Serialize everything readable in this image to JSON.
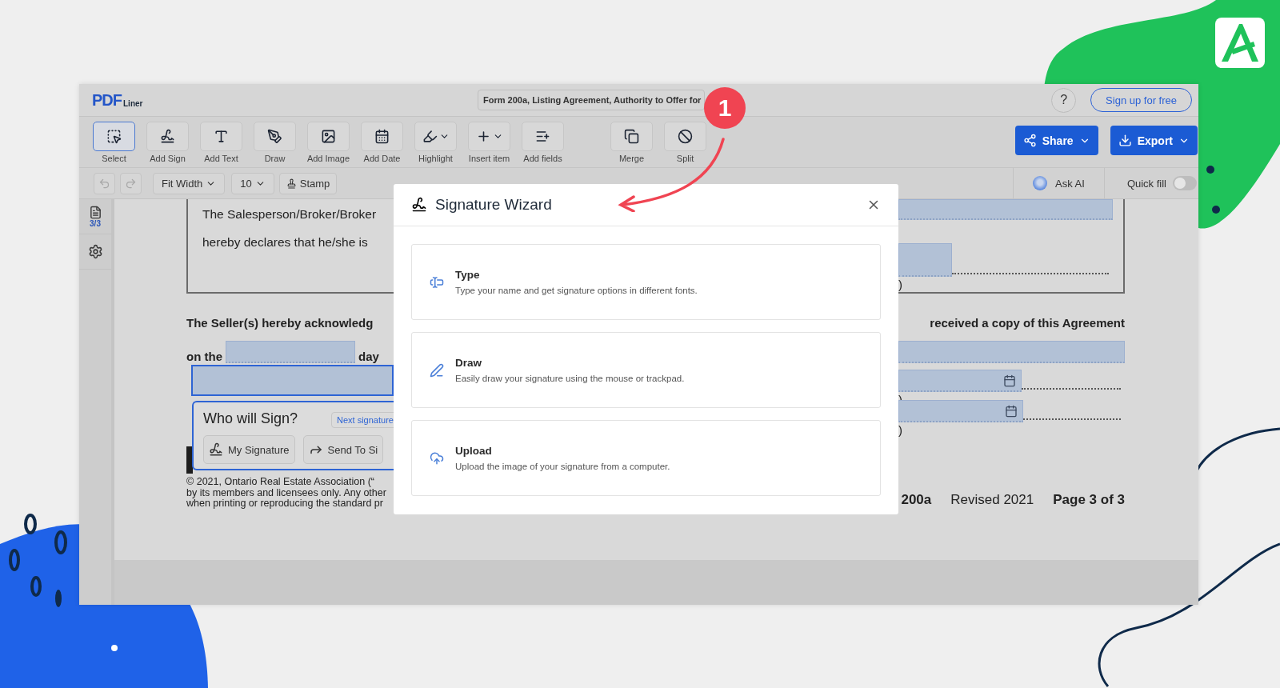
{
  "header": {
    "logo": {
      "mark": "PDF",
      "sub": "Liner"
    },
    "document_title": "Form 200a, Listing Agreement, Authority to Offer for",
    "help": "?",
    "signup": "Sign up for free"
  },
  "toolbar": {
    "tools": [
      {
        "label": "Select",
        "selected": true,
        "dropdown": false
      },
      {
        "label": "Add Sign",
        "selected": false,
        "dropdown": false
      },
      {
        "label": "Add Text",
        "selected": false,
        "dropdown": false
      },
      {
        "label": "Draw",
        "selected": false,
        "dropdown": false
      },
      {
        "label": "Add Image",
        "selected": false,
        "dropdown": false
      },
      {
        "label": "Add Date",
        "selected": false,
        "dropdown": false
      },
      {
        "label": "Highlight",
        "selected": false,
        "dropdown": true
      },
      {
        "label": "Insert item",
        "selected": false,
        "dropdown": true
      },
      {
        "label": "Add fields",
        "selected": false,
        "dropdown": false
      }
    ],
    "page_tools": [
      {
        "label": "Merge",
        "selected": false,
        "dropdown": false
      },
      {
        "label": "Split",
        "selected": false,
        "dropdown": false
      }
    ],
    "share": "Share",
    "export": "Export"
  },
  "subtoolbar": {
    "undo": {
      "disabled": true
    },
    "redo": {
      "disabled": true
    },
    "zoom": "Fit Width",
    "font_size": "10",
    "stamp": "Stamp",
    "ask_ai": "Ask AI",
    "quick_fill": {
      "label": "Quick fill",
      "on": false
    }
  },
  "sidebar": {
    "page_count": "3/3"
  },
  "document": {
    "box_lines": [
      "The Salesperson/Broker/Broker",
      "hereby declares that he/she is"
    ],
    "box_right_tail": ")",
    "ack_left": "The Seller(s) hereby acknowledg",
    "ack_right": "received a copy of this Agreement",
    "on_the": "on the",
    "day": "day",
    "sig_tails": [
      ")",
      ")"
    ],
    "copyright": [
      "© 2021, Ontario Real Estate Association (“",
      "by its members and licensees only. Any other",
      "when printing or reproducing the standard pr"
    ],
    "form_no": "200a",
    "revised": "Revised 2021",
    "page": "Page 3 of 3"
  },
  "who_will_sign": {
    "title": "Who will Sign?",
    "next": "Next signature",
    "options": [
      "My Signature",
      "Send To Si"
    ]
  },
  "modal": {
    "title": "Signature Wizard",
    "options": [
      {
        "title": "Type",
        "description": "Type your name and get signature options in different fonts."
      },
      {
        "title": "Draw",
        "description": "Easily draw your signature using the mouse or trackpad."
      },
      {
        "title": "Upload",
        "description": "Upload the image of your signature from a computer."
      }
    ]
  },
  "callout": {
    "number": "1"
  }
}
